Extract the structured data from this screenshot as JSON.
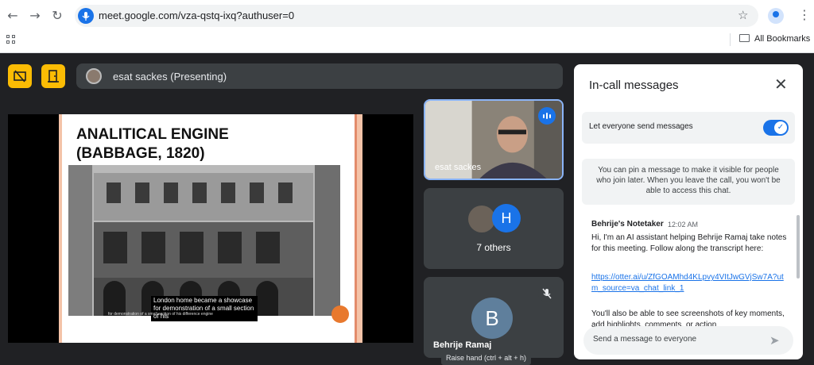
{
  "browser": {
    "url": "meet.google.com/vza-qstq-ixq?authuser=0",
    "bookmarks_label": "All Bookmarks"
  },
  "meet": {
    "presenter_label": "esat sackes (Presenting)",
    "slide": {
      "title": "ANALITICAL ENGINE\n(BABBAGE, 1820)",
      "caption": "London home became a showcase for demonstration of a small section of his",
      "caption_small": "for demonstration of a small section of his difference engine"
    },
    "tiles": [
      {
        "name": "esat sackes",
        "speaking": true
      },
      {
        "avatar_letter": "H",
        "label": "7 others"
      },
      {
        "avatar_letter": "B",
        "name": "Behrije Ramaj",
        "muted": true
      }
    ],
    "tooltip": "Raise hand (ctrl + alt + h)"
  },
  "chat": {
    "title": "In-call messages",
    "toggle_label": "Let everyone send messages",
    "toggle_on": true,
    "pin_note": "You can pin a message to make it visible for people who join later. When you leave the call, you won't be able to access this chat.",
    "message": {
      "sender": "Behrije's Notetaker",
      "time": "12:02 AM",
      "text": "Hi, I'm an AI assistant helping Behrije Ramaj take notes for this meeting. Follow along the transcript here:",
      "link": "https://otter.ai/u/ZfGOAMhd4KLpvy4VItJwGVjSw7A?utm_source=va_chat_link_1",
      "text2": "You'll also be able to see screenshots of key moments, add highlights, comments, or action"
    },
    "composer_placeholder": "Send a message to everyone"
  },
  "colors": {
    "accent": "#1a73e8",
    "warning": "#fbbc04",
    "meet_bg": "#202124"
  }
}
